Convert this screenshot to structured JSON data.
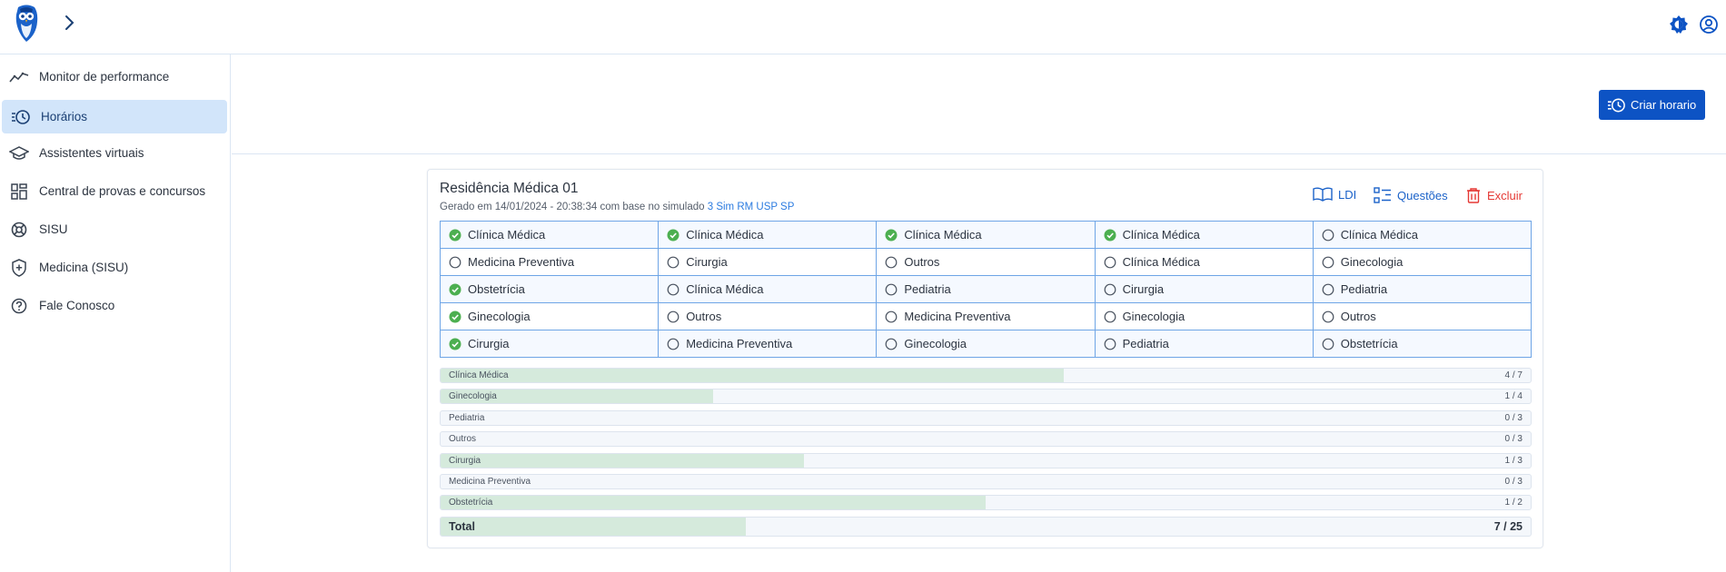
{
  "sidebar": {
    "items": [
      {
        "label": "Monitor de performance",
        "icon": "trending-chart-icon"
      },
      {
        "label": "Horários",
        "icon": "clock-list-icon",
        "active": true
      },
      {
        "label": "Assistentes virtuais",
        "icon": "graduation-cap-icon"
      },
      {
        "label": "Central de provas e concursos",
        "icon": "grid-icon"
      },
      {
        "label": "SISU",
        "icon": "lifebuoy-icon"
      },
      {
        "label": "Medicina (SISU)",
        "icon": "shield-plus-icon"
      },
      {
        "label": "Fale Conosco",
        "icon": "help-circle-icon"
      }
    ]
  },
  "header": {
    "create_label": "Criar horario"
  },
  "schedule": {
    "title": "Residência Médica 01",
    "subtitle_prefix": "Gerado em 14/01/2024 - 20:38:34 com base no simulado",
    "subtitle_link": "3 Sim RM USP SP",
    "actions": {
      "ldi": "LDI",
      "questoes": "Questões",
      "excluir": "Excluir"
    },
    "grid": [
      [
        {
          "label": "Clínica Médica",
          "done": true
        },
        {
          "label": "Clínica Médica",
          "done": true
        },
        {
          "label": "Clínica Médica",
          "done": true
        },
        {
          "label": "Clínica Médica",
          "done": true
        },
        {
          "label": "Clínica Médica",
          "done": false
        }
      ],
      [
        {
          "label": "Medicina Preventiva",
          "done": false
        },
        {
          "label": "Cirurgia",
          "done": false
        },
        {
          "label": "Outros",
          "done": false
        },
        {
          "label": "Clínica Médica",
          "done": false
        },
        {
          "label": "Ginecologia",
          "done": false
        }
      ],
      [
        {
          "label": "Obstetrícia",
          "done": true
        },
        {
          "label": "Clínica Médica",
          "done": false
        },
        {
          "label": "Pediatria",
          "done": false
        },
        {
          "label": "Cirurgia",
          "done": false
        },
        {
          "label": "Pediatria",
          "done": false
        }
      ],
      [
        {
          "label": "Ginecologia",
          "done": true
        },
        {
          "label": "Outros",
          "done": false
        },
        {
          "label": "Medicina Preventiva",
          "done": false
        },
        {
          "label": "Ginecologia",
          "done": false
        },
        {
          "label": "Outros",
          "done": false
        }
      ],
      [
        {
          "label": "Cirurgia",
          "done": true
        },
        {
          "label": "Medicina Preventiva",
          "done": false
        },
        {
          "label": "Ginecologia",
          "done": false
        },
        {
          "label": "Pediatria",
          "done": false
        },
        {
          "label": "Obstetrícia",
          "done": false
        }
      ]
    ],
    "progress": [
      {
        "label": "Clínica Médica",
        "count": "4 / 7",
        "fraction": 0.5714
      },
      {
        "label": "Ginecologia",
        "count": "1 / 4",
        "fraction": 0.25
      },
      {
        "label": "Pediatria",
        "count": "0 / 3",
        "fraction": 0
      },
      {
        "label": "Outros",
        "count": "0 / 3",
        "fraction": 0
      },
      {
        "label": "Cirurgia",
        "count": "1 / 3",
        "fraction": 0.3333
      },
      {
        "label": "Medicina Preventiva",
        "count": "0 / 3",
        "fraction": 0
      },
      {
        "label": "Obstetrícia",
        "count": "1 / 2",
        "fraction": 0.5
      }
    ],
    "total": {
      "label": "Total",
      "count": "7 / 25",
      "fraction": 0.28
    }
  },
  "colors": {
    "primary": "#0d53c4",
    "check_green": "#4caf50",
    "danger": "#e53935",
    "link": "#2b7be0",
    "progress_fill": "#d5eadc"
  }
}
